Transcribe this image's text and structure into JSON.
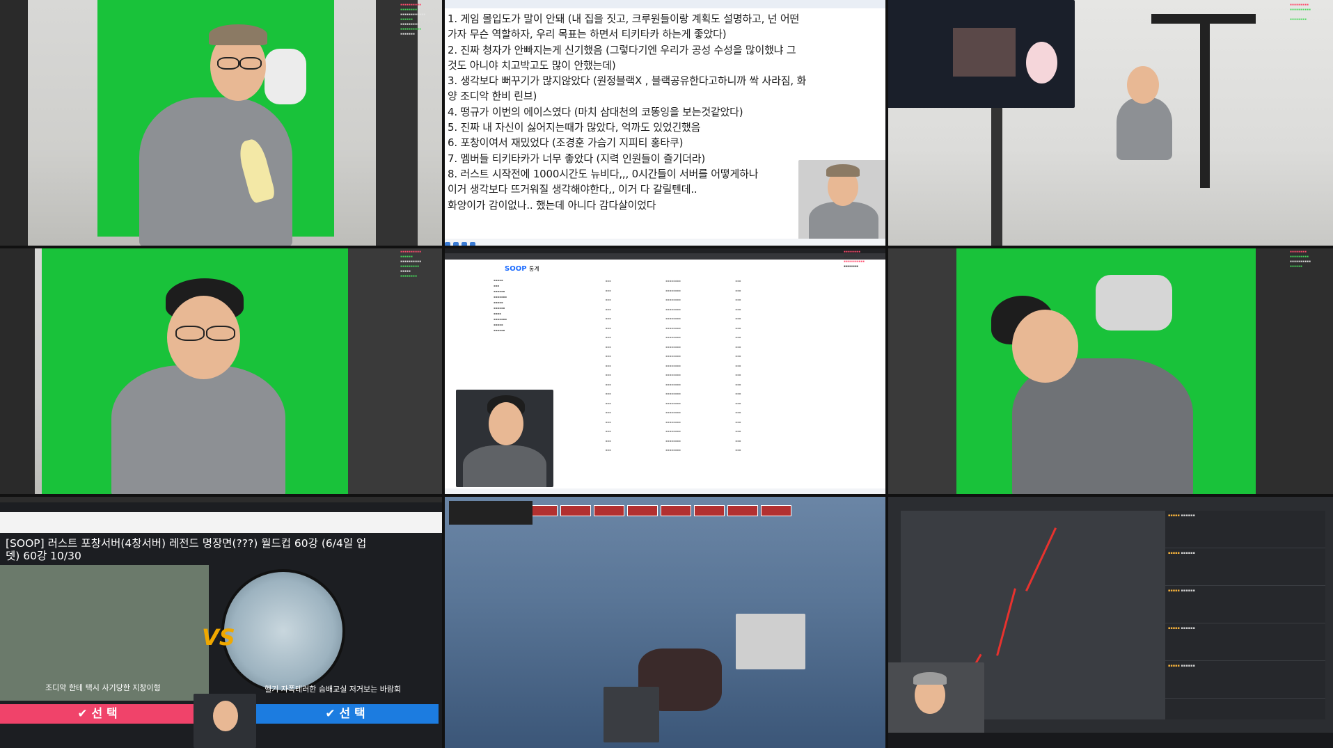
{
  "notes": {
    "lines": [
      "1. 게임 몰입도가 말이 안돼 (내 집을 짓고, 크루원들이랑 계획도 설명하고, 넌 어떤",
      "가자 무슨 역할하자, 우리 목표는 하면서 티키타카 하는게 좋았다)",
      "2. 진짜 청자가 안빠지는게 신기했음 (그렇다기엔 우리가 공성 수성을 많이했냐 그",
      "것도 아니야 치고박고도 많이 안했는데)",
      "3. 생각보다 뻐꾸기가 많지않았다 (원정블랙X , 블랙공유한다고하니까 싹 사라짐, 화",
      "양 조디악 한비 린브)",
      "4. 떵규가 이번의 에이스였다 (마치 삼대천의 코똥잉을 보는것같았다)",
      "5. 진짜 내 자신이 싫어지는때가 많았다, 억까도 있었긴했음",
      "6. 포창이여서 재밌었다 (조경훈 가슴기 지피티 홍타쿠)",
      "7. 멤버들 티키타카가 너무 좋았다 (지력 인원들이 즐기더라)",
      "8. 러스트 시작전에 1000시간도 뉴비다,,, 0시간들이 서버를 어떻게하나",
      "이거 생각보다 뜨거워질 생각해야한다,, 이거 다 갈릴텐데..",
      "화양이가 감이없나.. 했는데 아니다 감다살이었다"
    ]
  },
  "stats": {
    "logo_main": "SOOP",
    "logo_sub": "통계"
  },
  "rust_video": {
    "title": "[SOOP] 러스트 포창서버(4창서버) 레전드 명장면(???) 월드컵 60강 (6/4일 업뎃)  60강    10/30",
    "vs": "VS",
    "left_caption": "조디악 한테 택시 사기당한 지창이형",
    "right_caption": "헬기 자폭테러한 슴배교실 저거보는 바람회",
    "vote_left": "✔ 선 택",
    "vote_right": "✔ 선 택"
  },
  "colors": {
    "green_screen": "#19c23a",
    "vote_left": "#f0436a",
    "vote_right": "#1c7ce0"
  }
}
